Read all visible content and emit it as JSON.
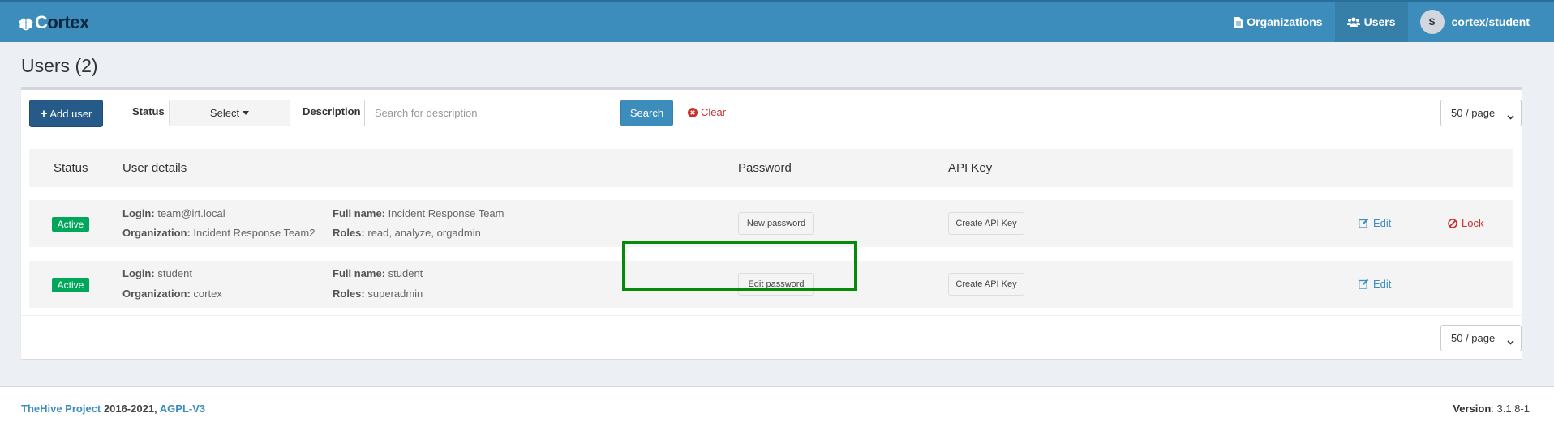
{
  "app": {
    "brand_letter": "C",
    "brand_rest": "ortex"
  },
  "nav": {
    "organizations": "Organizations",
    "users": "Users",
    "avatar_initial": "S",
    "account": "cortex/student"
  },
  "page": {
    "title": "Users (2)"
  },
  "toolbar": {
    "add_user": "Add user",
    "status_label": "Status",
    "status_select": "Select",
    "description_label": "Description",
    "description_placeholder": "Search for description",
    "search_button": "Search",
    "clear": "Clear",
    "page_size": "50 / page"
  },
  "table": {
    "headers": {
      "status": "Status",
      "user_details": "User details",
      "password": "Password",
      "api_key": "API Key"
    },
    "labels": {
      "login": "Login:",
      "organization": "Organization:",
      "full_name": "Full name:",
      "roles": "Roles:"
    },
    "rows": [
      {
        "status": "Active",
        "login": "team@irt.local",
        "organization": "Incident Response Team2",
        "full_name": "Incident Response Team",
        "roles": "read, analyze, orgadmin",
        "password_button": "New password",
        "api_key_button": "Create API Key",
        "edit": "Edit",
        "lock": "Lock"
      },
      {
        "status": "Active",
        "login": "student",
        "organization": "cortex",
        "full_name": "student",
        "roles": "superadmin",
        "password_button": "Edit password",
        "api_key_button": "Create API Key",
        "edit": "Edit"
      }
    ]
  },
  "footer_pager": {
    "page_size": "50 / page"
  },
  "footer": {
    "project_link": "TheHive Project",
    "years": " 2016-2021, ",
    "license_link": "AGPL-V3",
    "version_label": "Version",
    "version_value": ": 3.1.8-1"
  },
  "colors": {
    "navbar": "#3c8dbc",
    "active_badge": "#00a65a",
    "highlight_border": "#078a07",
    "primary_button": "#265a88"
  }
}
